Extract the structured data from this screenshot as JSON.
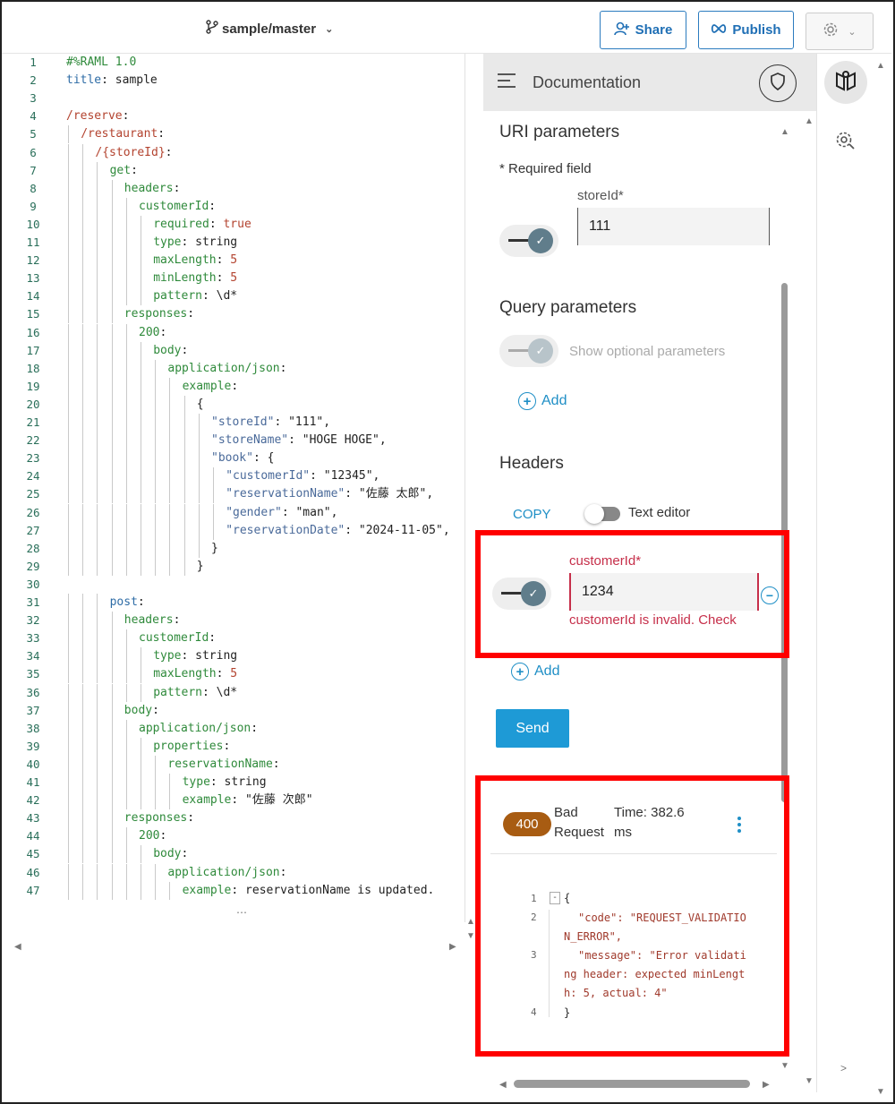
{
  "topbar": {
    "branch": "sample/master",
    "share_label": "Share",
    "publish_label": "Publish"
  },
  "editor": {
    "lines": [
      {
        "n": "1",
        "indent": 0,
        "parts": [
          [
            "k",
            "#%RAML 1.0"
          ]
        ]
      },
      {
        "n": "2",
        "indent": 0,
        "parts": [
          [
            "c-blue",
            "title"
          ],
          [
            "c-val",
            ": sample"
          ]
        ]
      },
      {
        "n": "3",
        "indent": 0,
        "parts": []
      },
      {
        "n": "4",
        "indent": 0,
        "parts": [
          [
            "c-red",
            "/reserve"
          ],
          [
            "c-val",
            ":"
          ]
        ]
      },
      {
        "n": "5",
        "indent": 1,
        "parts": [
          [
            "c-red",
            "/restaurant"
          ],
          [
            "c-val",
            ":"
          ]
        ]
      },
      {
        "n": "6",
        "indent": 2,
        "parts": [
          [
            "c-red",
            "/{storeId}"
          ],
          [
            "c-val",
            ":"
          ]
        ]
      },
      {
        "n": "7",
        "indent": 3,
        "parts": [
          [
            "k",
            "get"
          ],
          [
            "c-val",
            ":"
          ]
        ]
      },
      {
        "n": "8",
        "indent": 4,
        "parts": [
          [
            "k",
            "headers"
          ],
          [
            "c-val",
            ":"
          ]
        ]
      },
      {
        "n": "9",
        "indent": 5,
        "parts": [
          [
            "k",
            "customerId"
          ],
          [
            "c-val",
            ":"
          ]
        ]
      },
      {
        "n": "10",
        "indent": 6,
        "parts": [
          [
            "k",
            "required"
          ],
          [
            "c-val",
            ": "
          ],
          [
            "c-red",
            "true"
          ]
        ]
      },
      {
        "n": "11",
        "indent": 6,
        "parts": [
          [
            "k",
            "type"
          ],
          [
            "c-val",
            ": string"
          ]
        ]
      },
      {
        "n": "12",
        "indent": 6,
        "parts": [
          [
            "k",
            "maxLength"
          ],
          [
            "c-val",
            ": "
          ],
          [
            "c-red",
            "5"
          ]
        ]
      },
      {
        "n": "13",
        "indent": 6,
        "parts": [
          [
            "k",
            "minLength"
          ],
          [
            "c-val",
            ": "
          ],
          [
            "c-red",
            "5"
          ]
        ]
      },
      {
        "n": "14",
        "indent": 6,
        "parts": [
          [
            "k",
            "pattern"
          ],
          [
            "c-val",
            ": \\d*"
          ]
        ]
      },
      {
        "n": "15",
        "indent": 4,
        "parts": [
          [
            "k",
            "responses"
          ],
          [
            "c-val",
            ":"
          ]
        ]
      },
      {
        "n": "16",
        "indent": 5,
        "parts": [
          [
            "k",
            "200"
          ],
          [
            "c-val",
            ":"
          ]
        ]
      },
      {
        "n": "17",
        "indent": 6,
        "parts": [
          [
            "k",
            "body"
          ],
          [
            "c-val",
            ":"
          ]
        ]
      },
      {
        "n": "18",
        "indent": 7,
        "parts": [
          [
            "k",
            "application/json"
          ],
          [
            "c-val",
            ":"
          ]
        ]
      },
      {
        "n": "19",
        "indent": 8,
        "parts": [
          [
            "k",
            "example"
          ],
          [
            "c-val",
            ":"
          ]
        ]
      },
      {
        "n": "20",
        "indent": 9,
        "parts": [
          [
            "c-val",
            "{"
          ]
        ]
      },
      {
        "n": "21",
        "indent": 10,
        "parts": [
          [
            "c-str",
            "\"storeId\""
          ],
          [
            "c-val",
            ": \"111\","
          ]
        ]
      },
      {
        "n": "22",
        "indent": 10,
        "parts": [
          [
            "c-str",
            "\"storeName\""
          ],
          [
            "c-val",
            ": \"HOGE HOGE\","
          ]
        ]
      },
      {
        "n": "23",
        "indent": 10,
        "parts": [
          [
            "c-str",
            "\"book\""
          ],
          [
            "c-val",
            ": {"
          ]
        ]
      },
      {
        "n": "24",
        "indent": 11,
        "parts": [
          [
            "c-str",
            "\"customerId\""
          ],
          [
            "c-val",
            ": \"12345\","
          ]
        ]
      },
      {
        "n": "25",
        "indent": 11,
        "parts": [
          [
            "c-str",
            "\"reservationName\""
          ],
          [
            "c-val",
            ": \"佐藤 太郎\","
          ]
        ]
      },
      {
        "n": "26",
        "indent": 11,
        "parts": [
          [
            "c-str",
            "\"gender\""
          ],
          [
            "c-val",
            ": \"man\","
          ]
        ]
      },
      {
        "n": "27",
        "indent": 11,
        "parts": [
          [
            "c-str",
            "\"reservationDate\""
          ],
          [
            "c-val",
            ": \"2024-11-05\","
          ]
        ]
      },
      {
        "n": "28",
        "indent": 10,
        "parts": [
          [
            "c-val",
            "}"
          ]
        ]
      },
      {
        "n": "29",
        "indent": 9,
        "parts": [
          [
            "c-val",
            "}"
          ]
        ]
      },
      {
        "n": "30",
        "indent": 0,
        "parts": []
      },
      {
        "n": "31",
        "indent": 3,
        "parts": [
          [
            "c-blue",
            "post"
          ],
          [
            "c-val",
            ":"
          ]
        ]
      },
      {
        "n": "32",
        "indent": 4,
        "parts": [
          [
            "k",
            "headers"
          ],
          [
            "c-val",
            ":"
          ]
        ]
      },
      {
        "n": "33",
        "indent": 5,
        "parts": [
          [
            "k",
            "customerId"
          ],
          [
            "c-val",
            ":"
          ]
        ]
      },
      {
        "n": "34",
        "indent": 6,
        "parts": [
          [
            "k",
            "type"
          ],
          [
            "c-val",
            ": string"
          ]
        ]
      },
      {
        "n": "35",
        "indent": 6,
        "parts": [
          [
            "k",
            "maxLength"
          ],
          [
            "c-val",
            ": "
          ],
          [
            "c-red",
            "5"
          ]
        ]
      },
      {
        "n": "36",
        "indent": 6,
        "parts": [
          [
            "k",
            "pattern"
          ],
          [
            "c-val",
            ": \\d*"
          ]
        ]
      },
      {
        "n": "37",
        "indent": 4,
        "parts": [
          [
            "k",
            "body"
          ],
          [
            "c-val",
            ":"
          ]
        ]
      },
      {
        "n": "38",
        "indent": 5,
        "parts": [
          [
            "k",
            "application/json"
          ],
          [
            "c-val",
            ":"
          ]
        ]
      },
      {
        "n": "39",
        "indent": 6,
        "parts": [
          [
            "k",
            "properties"
          ],
          [
            "c-val",
            ":"
          ]
        ]
      },
      {
        "n": "40",
        "indent": 7,
        "parts": [
          [
            "k",
            "reservationName"
          ],
          [
            "c-val",
            ":"
          ]
        ]
      },
      {
        "n": "41",
        "indent": 8,
        "parts": [
          [
            "k",
            "type"
          ],
          [
            "c-val",
            ": string"
          ]
        ]
      },
      {
        "n": "42",
        "indent": 8,
        "parts": [
          [
            "k",
            "example"
          ],
          [
            "c-val",
            ": \"佐藤 次郎\""
          ]
        ]
      },
      {
        "n": "43",
        "indent": 4,
        "parts": [
          [
            "k",
            "responses"
          ],
          [
            "c-val",
            ":"
          ]
        ]
      },
      {
        "n": "44",
        "indent": 5,
        "parts": [
          [
            "k",
            "200"
          ],
          [
            "c-val",
            ":"
          ]
        ]
      },
      {
        "n": "45",
        "indent": 6,
        "parts": [
          [
            "k",
            "body"
          ],
          [
            "c-val",
            ":"
          ]
        ]
      },
      {
        "n": "46",
        "indent": 7,
        "parts": [
          [
            "k",
            "application/json"
          ],
          [
            "c-val",
            ":"
          ]
        ]
      },
      {
        "n": "47",
        "indent": 8,
        "parts": [
          [
            "k",
            "example"
          ],
          [
            "c-val",
            ": reservationName is updated."
          ]
        ]
      }
    ]
  },
  "doc": {
    "title": "Documentation",
    "uri_title": "URI parameters",
    "required_note": "* Required field",
    "storeid_label": "storeId*",
    "storeid_value": "111",
    "query_title": "Query parameters",
    "show_optional": "Show optional parameters",
    "add_label": "Add",
    "headers_title": "Headers",
    "copy_label": "COPY",
    "text_editor_label": "Text editor",
    "customerid_label": "customerId*",
    "customerid_value": "1234",
    "customerid_error": "customerId is invalid. Check",
    "add_label_2": "Add",
    "send_label": "Send"
  },
  "response": {
    "status_code": "400",
    "status_line1": "Bad",
    "status_line2": "Request",
    "time_line1": "Time: 382.6",
    "time_line2": "ms",
    "line_numbers": [
      "1",
      "2",
      "3",
      "4"
    ],
    "code_lines": [
      "{",
      "\"code\": \"REQUEST_VALIDATIO",
      "N_ERROR\",",
      "\"message\": \"Error validati",
      "ng header: expected minLengt",
      "h: 5, actual: 4\"",
      "}"
    ]
  },
  "colors": {
    "accent": "#1f8fc6",
    "error": "#c62f4a",
    "highlight": "#ff0000",
    "badge": "#a85c12"
  },
  "icons": [
    "branch-icon",
    "share-user-icon",
    "publish-icon",
    "gear-icon",
    "menu-icon",
    "shield-icon",
    "docs-book-icon",
    "settings-cog-icon"
  ]
}
